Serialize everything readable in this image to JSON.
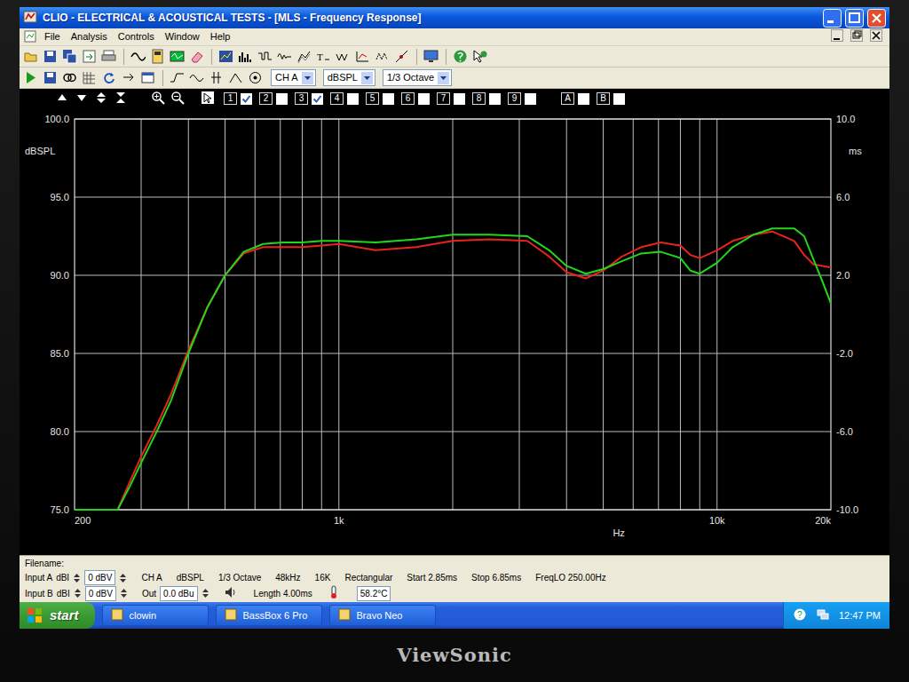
{
  "window": {
    "title": "CLIO - ELECTRICAL & ACOUSTICAL TESTS - [MLS - Frequency Response]"
  },
  "menu": [
    "File",
    "Analysis",
    "Controls",
    "Window",
    "Help"
  ],
  "toolbar": {
    "channel": "CH A",
    "units": "dBSPL",
    "smoothing": "1/3 Octave"
  },
  "chart_toolbar": {
    "memories": [
      {
        "label": "1",
        "checked": true
      },
      {
        "label": "2",
        "checked": false
      },
      {
        "label": "3",
        "checked": true
      },
      {
        "label": "4",
        "checked": false
      },
      {
        "label": "5",
        "checked": false
      },
      {
        "label": "6",
        "checked": false
      },
      {
        "label": "7",
        "checked": false
      },
      {
        "label": "8",
        "checked": false
      },
      {
        "label": "9",
        "checked": false
      }
    ],
    "overlays": [
      "A",
      "B"
    ]
  },
  "chart": {
    "y_axis": {
      "unit": "dBSPL",
      "min": 75,
      "max": 100,
      "ticks": [
        "100.0",
        "95.0",
        "90.0",
        "85.0",
        "80.0",
        "75.0"
      ]
    },
    "y2_axis": {
      "unit": "ms",
      "min": -10,
      "max": 10,
      "ticks": [
        "10.0",
        "6.0",
        "2.0",
        "-2.0",
        "-6.0",
        "-10.0"
      ]
    },
    "x_axis": {
      "unit": "Hz",
      "min": 200,
      "max": 20000,
      "ticks": [
        {
          "label": "200",
          "value": 200
        },
        {
          "label": "1k",
          "value": 1000
        },
        {
          "label": "10k",
          "value": 10000
        },
        {
          "label": "20k",
          "value": 20000
        }
      ]
    },
    "frequencies": [
      200,
      250,
      260,
      280,
      300,
      330,
      360,
      400,
      450,
      500,
      560,
      630,
      710,
      800,
      900,
      1000,
      1250,
      1600,
      2000,
      2500,
      3150,
      3600,
      4000,
      4500,
      5000,
      5600,
      6300,
      7100,
      8000,
      8500,
      9000,
      10000,
      11000,
      12500,
      14000,
      16000,
      17000,
      18000,
      19000,
      20000
    ],
    "series": [
      {
        "color": "#e8231c",
        "values": [
          75,
          75,
          75,
          76.8,
          78.4,
          80.4,
          82.4,
          85.2,
          88,
          90,
          91.4,
          91.8,
          91.8,
          91.8,
          91.9,
          92.0,
          91.6,
          91.8,
          92.2,
          92.3,
          92.2,
          91.2,
          90.2,
          89.8,
          90.3,
          91.2,
          91.8,
          92.1,
          91.9,
          91.3,
          91.1,
          91.6,
          92.2,
          92.6,
          92.8,
          92.2,
          91.3,
          90.7,
          90.6,
          90.5
        ]
      },
      {
        "color": "#22d61a",
        "values": [
          75,
          75,
          75,
          76.5,
          78,
          80,
          82,
          85,
          88,
          90,
          91.5,
          92,
          92.1,
          92.1,
          92.2,
          92.2,
          92.1,
          92.3,
          92.6,
          92.6,
          92.5,
          91.6,
          90.6,
          90.1,
          90.4,
          90.9,
          91.4,
          91.5,
          91.1,
          90.3,
          90.1,
          90.8,
          91.8,
          92.6,
          93.0,
          93.0,
          92.5,
          91.0,
          89.6,
          88.2
        ]
      }
    ]
  },
  "status_bar": {
    "filename_label": "Filename:",
    "input_a": {
      "label": "Input A",
      "unit": "dBI",
      "value": "0 dBV"
    },
    "input_b": {
      "label": "Input B",
      "unit": "dBI",
      "value": "0 dBV"
    },
    "channel": "CH A",
    "units": "dBSPL",
    "settings": [
      "1/3 Octave",
      "48kHz",
      "16K",
      "Rectangular",
      "Start 2.85ms",
      "Stop 6.85ms",
      "FreqLO 250.00Hz"
    ],
    "output": {
      "label": "Out",
      "value": "0.0 dBu"
    },
    "length": "Length 4.00ms",
    "temperature": "58.2°C"
  },
  "taskbar": {
    "start": "start",
    "items": [
      "clowin",
      "BassBox 6 Pro",
      "Bravo Neo"
    ],
    "clock": "12:47 PM"
  },
  "monitor": {
    "brand": "ViewSonic"
  }
}
